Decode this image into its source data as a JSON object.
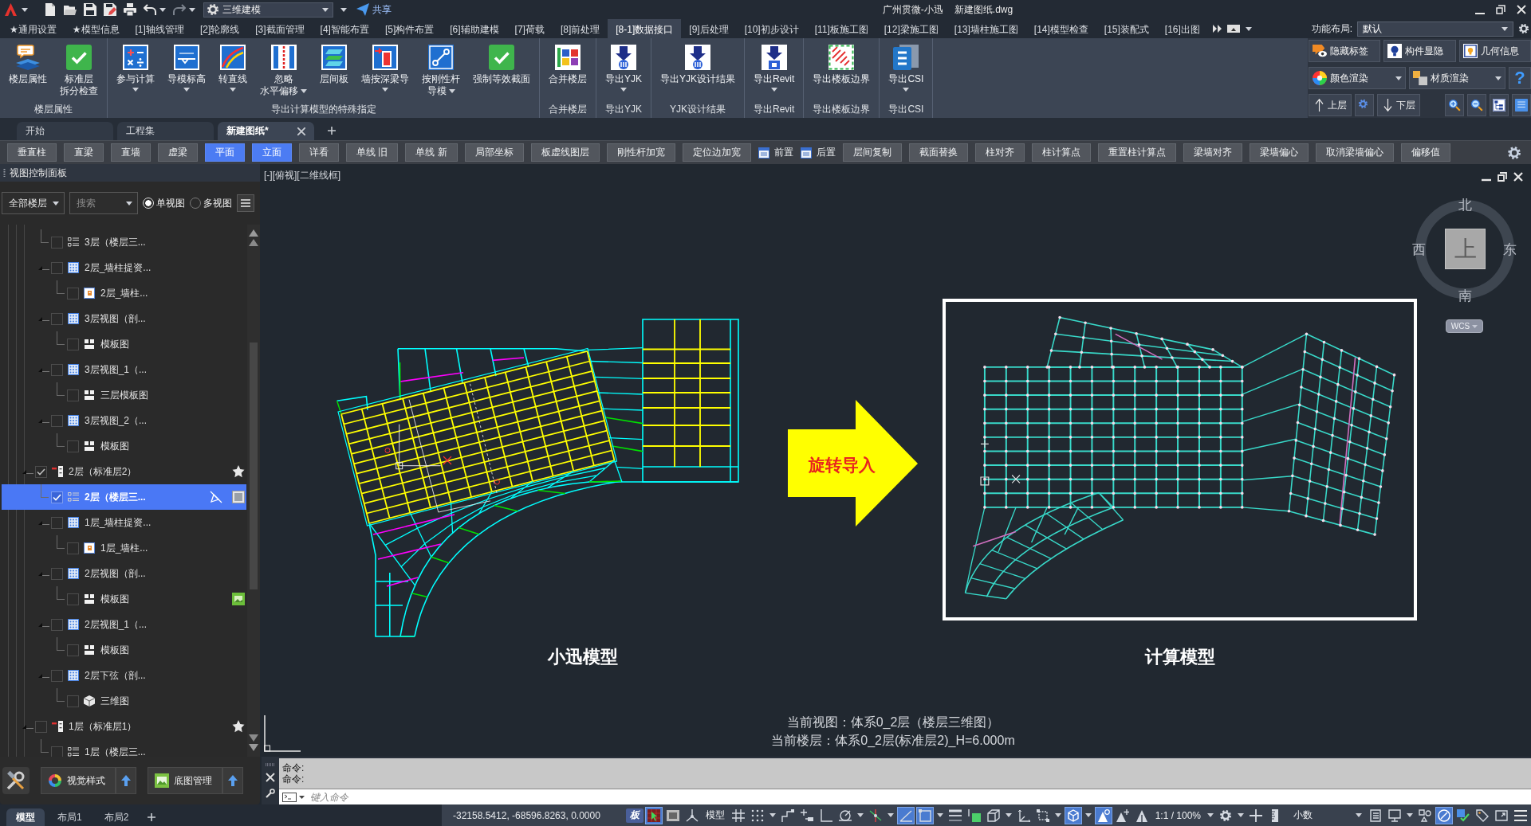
{
  "title_bar": {
    "workspace": "三维建模",
    "share": "共享",
    "app_name": "广州贯微-小迅",
    "file_name": "新建图纸.dwg"
  },
  "menu_tabs": [
    {
      "label": "★通用设置",
      "selected": false
    },
    {
      "label": "★模型信息",
      "selected": false
    },
    {
      "label": "[1]轴线管理",
      "selected": false
    },
    {
      "label": "[2]轮廓线",
      "selected": false
    },
    {
      "label": "[3]截面管理",
      "selected": false
    },
    {
      "label": "[4]智能布置",
      "selected": false
    },
    {
      "label": "[5]构件布置",
      "selected": false
    },
    {
      "label": "[6]辅助建模",
      "selected": false
    },
    {
      "label": "[7]荷载",
      "selected": false
    },
    {
      "label": "[8]前处理",
      "selected": false
    },
    {
      "label": "[8-1]数据接口",
      "selected": true
    },
    {
      "label": "[9]后处理",
      "selected": false
    },
    {
      "label": "[10]初步设计",
      "selected": false
    },
    {
      "label": "[11]板施工图",
      "selected": false
    },
    {
      "label": "[12]梁施工图",
      "selected": false
    },
    {
      "label": "[13]墙柱施工图",
      "selected": false
    },
    {
      "label": "[14]模型检查",
      "selected": false
    },
    {
      "label": "[15]装配式",
      "selected": false
    },
    {
      "label": "[16]出图",
      "selected": false
    }
  ],
  "layout_selector": {
    "label": "功能布局:",
    "value": "默认"
  },
  "ribbon": {
    "groups": [
      {
        "title": "楼层属性",
        "buttons": [
          {
            "lines": [
              "楼层属性"
            ],
            "kind": "floor-props",
            "dropdown": false
          },
          {
            "lines": [
              "标准层",
              "拆分检查"
            ],
            "kind": "check",
            "dropdown": false
          }
        ]
      },
      {
        "title": "导出计算模型的特殊指定",
        "buttons": [
          {
            "lines": [
              "参与计算"
            ],
            "kind": "calc",
            "dropdown": true
          },
          {
            "lines": [
              "导模标高"
            ],
            "kind": "elevation",
            "dropdown": true
          },
          {
            "lines": [
              "转直线"
            ],
            "kind": "curve",
            "dropdown": true
          },
          {
            "lines": [
              "忽略",
              "水平偏移"
            ],
            "kind": "offset",
            "dropdown": true
          },
          {
            "lines": [
              "层间板"
            ],
            "kind": "slab",
            "dropdown": false
          },
          {
            "lines": [
              "墙按深梁导"
            ],
            "kind": "beam",
            "dropdown": true
          },
          {
            "lines": [
              "按刚性杆",
              "导模"
            ],
            "kind": "link",
            "dropdown": true
          },
          {
            "lines": [
              "强制等效截面"
            ],
            "kind": "check",
            "dropdown": false
          }
        ]
      },
      {
        "title": "合并楼层",
        "buttons": [
          {
            "lines": [
              "合并楼层"
            ],
            "kind": "merge",
            "dropdown": false
          }
        ]
      },
      {
        "title": "导出YJK",
        "buttons": [
          {
            "lines": [
              "导出YJK"
            ],
            "kind": "export",
            "dropdown": true
          }
        ]
      },
      {
        "title": "YJK设计结果",
        "buttons": [
          {
            "lines": [
              "导出YJK设计结果"
            ],
            "kind": "export",
            "dropdown": false
          }
        ]
      },
      {
        "title": "导出Revit",
        "buttons": [
          {
            "lines": [
              "导出Revit"
            ],
            "kind": "revit",
            "dropdown": true
          }
        ]
      },
      {
        "title": "导出楼板边界",
        "buttons": [
          {
            "lines": [
              "导出楼板边界"
            ],
            "kind": "boundary",
            "dropdown": false
          }
        ]
      },
      {
        "title": "导出CSI",
        "buttons": [
          {
            "lines": [
              "导出CSI"
            ],
            "kind": "csi",
            "dropdown": true
          }
        ]
      }
    ]
  },
  "quick_panel": {
    "rows": [
      [
        {
          "kind": "tag",
          "label": "隐藏标签",
          "dropdown": false
        },
        {
          "kind": "bulb",
          "label": "构件显隐",
          "dropdown": false
        },
        {
          "kind": "frame",
          "label": "几何信息",
          "dropdown": false
        }
      ],
      [
        {
          "kind": "color-wheel",
          "label": "颜色渲染",
          "dropdown": true
        },
        {
          "kind": "material",
          "label": "材质渲染",
          "dropdown": true
        },
        {
          "kind": "help",
          "label": "?"
        }
      ],
      [
        {
          "kind": "up",
          "label": "上层",
          "dropdown": false
        },
        {
          "kind": "gear"
        },
        {
          "kind": "down",
          "label": "下层",
          "dropdown": false
        },
        {
          "kind": "zoom-in"
        },
        {
          "kind": "zoom-out"
        },
        {
          "kind": "tree"
        },
        {
          "kind": "doc"
        }
      ]
    ]
  },
  "document_tabs": [
    {
      "label": "开始",
      "selected": false
    },
    {
      "label": "工程集",
      "selected": false
    },
    {
      "label": "新建图纸*",
      "selected": true
    }
  ],
  "toolbar": [
    {
      "kind": "button",
      "label": "垂直柱",
      "on": false
    },
    {
      "kind": "button",
      "label": "直梁",
      "on": false
    },
    {
      "kind": "button",
      "label": "直墙",
      "on": false
    },
    {
      "kind": "button",
      "label": "虚梁",
      "on": false
    },
    {
      "kind": "button",
      "label": "平面",
      "on": true
    },
    {
      "kind": "button",
      "label": "立面",
      "on": true
    },
    {
      "kind": "button",
      "label": "详看",
      "on": false
    },
    {
      "kind": "button",
      "label": "单线 旧",
      "on": false
    },
    {
      "kind": "button",
      "label": "单线 新",
      "on": false
    },
    {
      "kind": "button",
      "label": "局部坐标",
      "on": false
    },
    {
      "kind": "button",
      "label": "板虚线图层",
      "on": false
    },
    {
      "kind": "button",
      "label": "刚性杆加宽",
      "on": false
    },
    {
      "kind": "button",
      "label": "定位边加宽",
      "on": false
    },
    {
      "kind": "option",
      "label": "前置"
    },
    {
      "kind": "option",
      "label": "后置"
    },
    {
      "kind": "button",
      "label": "层间复制",
      "on": false
    },
    {
      "kind": "button",
      "label": "截面替换",
      "on": false
    },
    {
      "kind": "button",
      "label": "柱对齐",
      "on": false
    },
    {
      "kind": "button",
      "label": "柱计算点",
      "on": false
    },
    {
      "kind": "button",
      "label": "重置柱计算点",
      "on": false
    },
    {
      "kind": "button",
      "label": "梁墙对齐",
      "on": false
    },
    {
      "kind": "button",
      "label": "梁墙偏心",
      "on": false
    },
    {
      "kind": "button",
      "label": "取消梁墙偏心",
      "on": false
    },
    {
      "kind": "button",
      "label": "偏移值",
      "on": false
    }
  ],
  "view_panel": {
    "title": "视图控制面板",
    "floor_filter": "全部楼层",
    "search": {
      "placeholder": "搜索"
    },
    "view_modes": [
      {
        "label": "单视图",
        "selected": true
      },
      {
        "label": "多视图",
        "selected": false
      }
    ],
    "tree": [
      {
        "children": [
          {
            "label": "3层（楼层三...",
            "kind": "floor3d",
            "checked": false,
            "selected": false
          },
          {
            "label": "2层_墙柱提资...",
            "kind": "view",
            "checked": false,
            "selected": false,
            "children": [
              {
                "label": "2层_墙柱...",
                "kind": "sheet",
                "checked": false,
                "selected": false
              }
            ]
          },
          {
            "label": "3层视图（剖...",
            "kind": "view",
            "checked": false,
            "selected": false,
            "children": [
              {
                "label": "模板图",
                "kind": "template",
                "checked": false,
                "selected": false
              }
            ]
          },
          {
            "label": "3层视图_1（...",
            "kind": "view",
            "checked": false,
            "selected": false,
            "children": [
              {
                "label": "三层模板图",
                "kind": "template",
                "checked": false,
                "selected": false
              }
            ]
          },
          {
            "label": "3层视图_2（...",
            "kind": "view",
            "checked": false,
            "selected": false,
            "children": [
              {
                "label": "模板图",
                "kind": "template",
                "checked": false,
                "selected": false
              }
            ]
          }
        ]
      },
      {
        "label": "2层（标准层2）",
        "kind": "standard",
        "checked": true,
        "selected": false,
        "children": [
          {
            "label": "2层（楼层三...",
            "kind": "floor3d",
            "checked": true,
            "selected": true
          },
          {
            "label": "1层_墙柱提资...",
            "kind": "view",
            "checked": false,
            "selected": false,
            "children": [
              {
                "label": "1层_墙柱...",
                "kind": "sheet",
                "checked": false,
                "selected": false
              }
            ]
          },
          {
            "label": "2层视图（剖...",
            "kind": "view",
            "checked": false,
            "selected": false,
            "children": [
              {
                "label": "模板图",
                "kind": "template",
                "checked": false,
                "selected": false,
                "image_badge": true
              }
            ]
          },
          {
            "label": "2层视图_1（...",
            "kind": "view",
            "checked": false,
            "selected": false,
            "children": [
              {
                "label": "模板图",
                "kind": "template",
                "checked": false,
                "selected": false
              }
            ]
          },
          {
            "label": "2层下弦（剖...",
            "kind": "view",
            "checked": false,
            "selected": false,
            "children": [
              {
                "label": "三维图",
                "kind": "model3d",
                "checked": false,
                "selected": false
              }
            ]
          }
        ]
      },
      {
        "label": "1层（标准层1）",
        "kind": "standard",
        "checked": false,
        "selected": false,
        "children": [
          {
            "label": "1层（楼层三...",
            "kind": "floor3d",
            "checked": false,
            "selected": false
          }
        ]
      }
    ]
  },
  "canvas": {
    "view_label": "[-][俯视][二维线框]",
    "compass": {
      "north": "北",
      "south": "南",
      "west": "西",
      "east": "东",
      "top": "上",
      "wcs": "WCS"
    },
    "arrow_text": "旋转导入",
    "models": [
      {
        "label": "小迅模型"
      },
      {
        "label": "计算模型"
      }
    ],
    "info_lines": [
      "当前视图：体系0_2层（楼层三维图）",
      "当前楼层：体系0_2层(标准层2)_H=6.000m"
    ]
  },
  "tool_buttons": [
    {
      "kind": "visual-style",
      "label": "视觉样式"
    },
    {
      "kind": "base-map",
      "label": "底图管理"
    }
  ],
  "command": {
    "history": [
      "命令:",
      "命令:"
    ],
    "placeholder": "键入命令"
  },
  "status_bar": {
    "layouts": [
      {
        "label": "模型",
        "selected": true
      },
      {
        "label": "布局1",
        "selected": false
      },
      {
        "label": "布局2",
        "selected": false
      }
    ],
    "coordinates": "-32158.5412, -68596.8263, 0.0000",
    "items": [
      {
        "kind": "slab-badge",
        "label": "板",
        "on": false
      },
      {
        "kind": "cursor",
        "on": true
      },
      {
        "kind": "screen",
        "on": false
      },
      {
        "kind": "axes",
        "on": false
      },
      {
        "kind": "text",
        "label": "模型",
        "on": false
      },
      {
        "kind": "grid",
        "on": false
      },
      {
        "kind": "snap",
        "on": false,
        "caret": true
      },
      {
        "kind": "step",
        "on": false
      },
      {
        "kind": "plus-line",
        "on": false
      },
      {
        "kind": "right-angle",
        "on": false
      },
      {
        "kind": "polar",
        "on": false,
        "caret": true
      },
      {
        "kind": "osnap",
        "on": false,
        "caret": true
      },
      {
        "kind": "angle",
        "on": true
      },
      {
        "kind": "frame",
        "on": true,
        "caret": true
      },
      {
        "kind": "lineweight",
        "on": false
      },
      {
        "kind": "transparency",
        "on": false
      },
      {
        "kind": "cube",
        "on": false,
        "caret": true
      },
      {
        "kind": "ucs",
        "on": false
      },
      {
        "kind": "select-box",
        "on": false,
        "caret": true
      },
      {
        "kind": "gizmo",
        "on": true,
        "caret": true
      },
      {
        "kind": "annotate",
        "on": true
      },
      {
        "kind": "annotate-add",
        "on": false
      },
      {
        "kind": "annotate-scale",
        "on": false
      },
      {
        "kind": "text",
        "label": "1:1 / 100%",
        "on": false,
        "caret": true
      },
      {
        "kind": "gear",
        "on": false,
        "caret": true
      },
      {
        "kind": "plus",
        "on": false
      },
      {
        "kind": "ruler",
        "on": false
      },
      {
        "kind": "select",
        "label": "小数",
        "on": false
      },
      {
        "kind": "properties",
        "on": false
      },
      {
        "kind": "monitor",
        "on": false,
        "caret": true
      },
      {
        "kind": "shapes",
        "on": false
      },
      {
        "kind": "isolate",
        "on": true
      },
      {
        "kind": "hardware",
        "on": false
      },
      {
        "kind": "tag",
        "on": false
      },
      {
        "kind": "fullscreen",
        "on": false
      },
      {
        "kind": "menu",
        "on": false
      }
    ]
  }
}
